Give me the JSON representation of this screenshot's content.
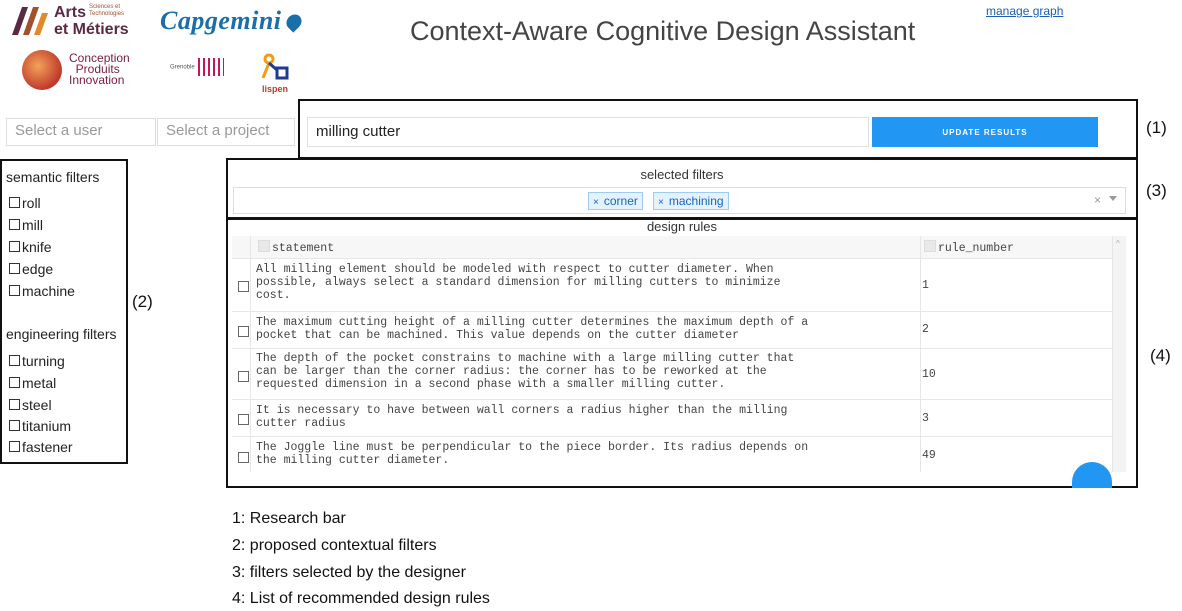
{
  "logos": {
    "arts_line1": "Arts",
    "arts_line2": "et Métiers",
    "arts_small1": "Sciences et",
    "arts_small2": "Technologies",
    "capgemini": "Capgemini",
    "cpi_line1": "Conception",
    "cpi_line2": "Produits",
    "cpi_line3": "Innovation",
    "grenoble": "Grenoble",
    "lispen": "lispen"
  },
  "header": {
    "title": "Context-Aware Cognitive Design Assistant",
    "manage_link": "manage graph"
  },
  "selectors": {
    "user_placeholder": "Select a user",
    "project_placeholder": "Select a project"
  },
  "search": {
    "value": "milling cutter",
    "button": "UPDATE RESULTS"
  },
  "semantic_filters": {
    "title": "semantic filters",
    "items": [
      "roll",
      "mill",
      "knife",
      "edge",
      "machine"
    ]
  },
  "engineering_filters": {
    "title": "engineering filters",
    "items": [
      "turning",
      "metal",
      "steel",
      "titanium",
      "fastener"
    ]
  },
  "selected_filters": {
    "title": "selected filters",
    "chips": [
      "corner",
      "machining"
    ],
    "remove_glyph": "×",
    "clear_glyph": "×"
  },
  "design_rules": {
    "title": "design rules",
    "columns": [
      "statement",
      "rule_number"
    ],
    "rows": [
      {
        "statement_lines": [
          "All milling element should be modeled with respect to cutter diameter. When",
          "possible, always select a standard dimension for milling cutters to minimize",
          "cost."
        ],
        "rule_number": "1"
      },
      {
        "statement_lines": [
          "The maximum cutting height of a milling cutter determines the maximum depth of a",
          "pocket that can be machined. This value depends on the cutter diameter"
        ],
        "rule_number": "2"
      },
      {
        "statement_lines": [
          "The depth of the pocket constrains to machine with a large milling cutter that",
          "can be larger than the corner radius: the corner has to be reworked at the",
          "requested dimension in a second phase with a smaller milling cutter."
        ],
        "rule_number": "10"
      },
      {
        "statement_lines": [
          "It is necessary to have between wall corners a radius higher than the milling",
          "cutter radius"
        ],
        "rule_number": "3"
      },
      {
        "statement_lines": [
          "The Joggle line must be perpendicular to the piece border. Its radius depends on",
          "the milling cutter diameter."
        ],
        "rule_number": "49"
      }
    ]
  },
  "annotations": {
    "box1": "(1)",
    "box2": "(2)",
    "box3": "(3)",
    "box4": "(4)"
  },
  "legend": [
    "1: Research bar",
    "2: proposed contextual filters",
    "3: filters selected by the designer",
    "4: List of recommended design rules"
  ],
  "colors": {
    "accent": "#2196f3",
    "chip_bg": "#e3f2fd",
    "link": "#1a5fb4"
  }
}
